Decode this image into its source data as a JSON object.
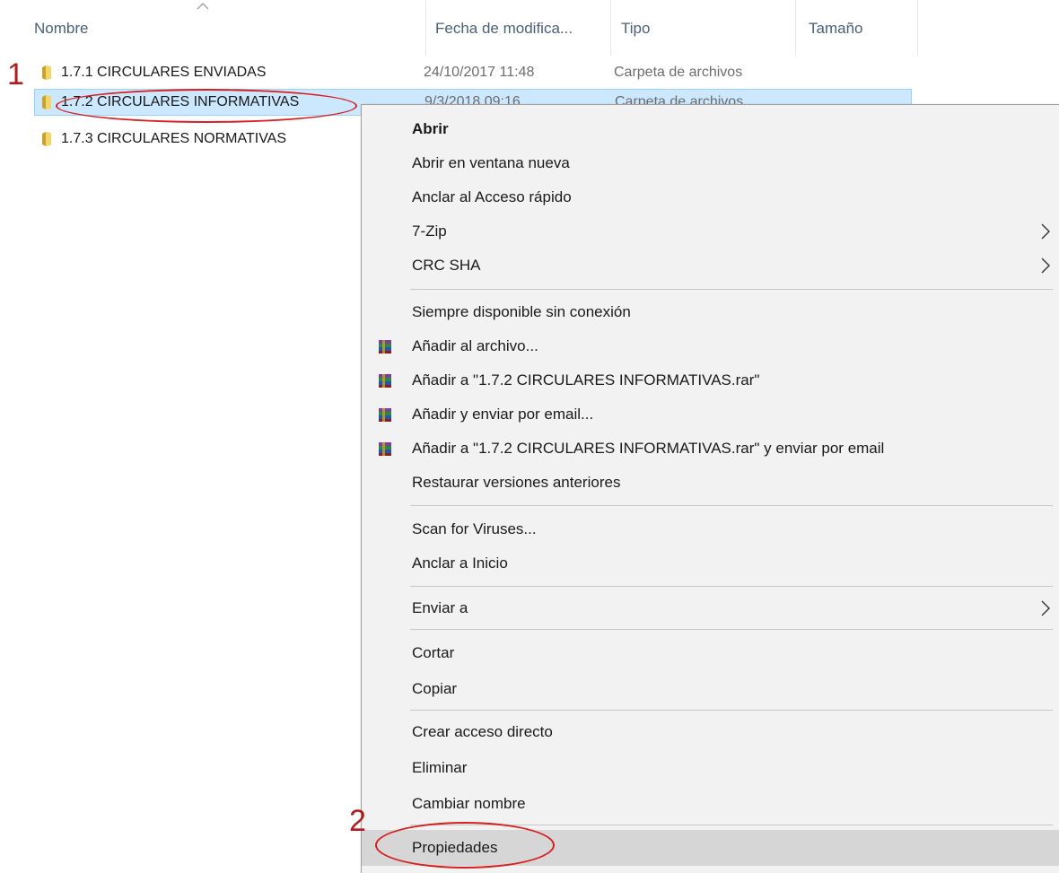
{
  "columns": {
    "name": "Nombre",
    "date": "Fecha de modifica...",
    "type": "Tipo",
    "size": "Tamaño"
  },
  "files": [
    {
      "name": "1.7.1 CIRCULARES ENVIADAS",
      "date": "24/10/2017 11:48",
      "type": "Carpeta de archivos",
      "selected": false
    },
    {
      "name": "1.7.2 CIRCULARES INFORMATIVAS",
      "date": "9/3/2018 09:16",
      "type": "Carpeta de archivos",
      "selected": true
    },
    {
      "name": "1.7.3 CIRCULARES NORMATIVAS",
      "date": "",
      "type": "",
      "selected": false
    }
  ],
  "menu": {
    "open": "Abrir",
    "open_new_window": "Abrir en ventana nueva",
    "pin_quick_access": "Anclar al Acceso rápido",
    "zip": "7-Zip",
    "crc": "CRC SHA",
    "offline": "Siempre disponible sin conexión",
    "add_archive": "Añadir al archivo...",
    "add_rar": "Añadir a \"1.7.2 CIRCULARES INFORMATIVAS.rar\"",
    "add_email": "Añadir y enviar por email...",
    "add_rar_email": "Añadir a \"1.7.2 CIRCULARES INFORMATIVAS.rar\" y enviar por email",
    "restore": "Restaurar versiones anteriores",
    "scan": "Scan for Viruses...",
    "pin_start": "Anclar a Inicio",
    "send_to": "Enviar a",
    "cut": "Cortar",
    "copy": "Copiar",
    "shortcut": "Crear acceso directo",
    "delete": "Eliminar",
    "rename": "Cambiar nombre",
    "properties": "Propiedades"
  },
  "annotations": {
    "step1": "1",
    "step2": "2",
    "color": "#d81e1e"
  },
  "colors": {
    "selection": "#cce8ff",
    "menu_bg": "#f2f2f2",
    "menu_hover": "#d6d6d6",
    "header_text": "#4c607a",
    "folder": "#e8c75a"
  },
  "icons": [
    "folder-icon",
    "winrar-icon",
    "chevron-right-icon",
    "sort-up-icon"
  ]
}
